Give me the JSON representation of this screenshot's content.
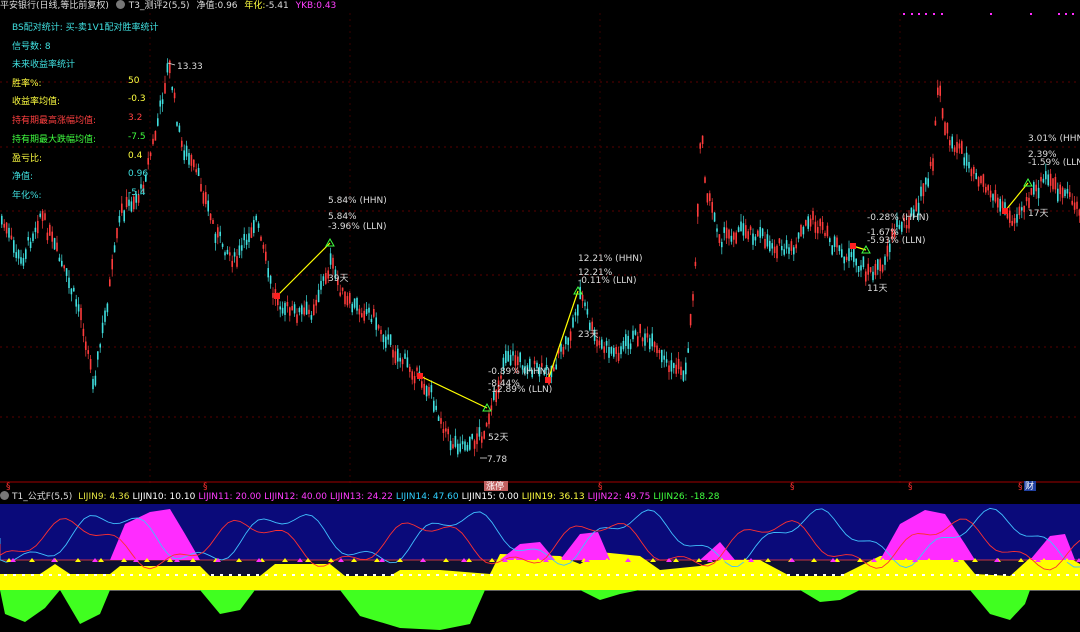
{
  "topbar": {
    "stock_title": "平安银行(日线,等比前复权)",
    "formula_name": "T3_测评2(5,5)",
    "net_label": "净值:",
    "net_value": "0.96",
    "annual_label": "年化:",
    "annual_value": "-5.41",
    "ykb_label": "YKB:",
    "ykb_value": "0.43"
  },
  "stats": {
    "line1": "BS配对统计: 买-卖1V1配对胜率统计",
    "line2": "信号数: 8",
    "line3": "未来收益率统计",
    "rows": [
      {
        "label": "胜率%:",
        "value": "50"
      },
      {
        "label": "收益率均值:",
        "value": "-0.3"
      },
      {
        "label": "持有期最高涨幅均值:",
        "value": "3.2"
      },
      {
        "label": "持有期最大跌幅均值:",
        "value": "-7.5"
      },
      {
        "label": "盈亏比:",
        "value": "0.4"
      },
      {
        "label": "净值:",
        "value": "0.96"
      },
      {
        "label": "年化%:",
        "value": "-5.4"
      }
    ]
  },
  "annotations": {
    "high": "13.33",
    "low": "7.78",
    "a1_hhn": "5.84% (HHN)",
    "a1_pct": "5.84%",
    "a1_lln": "-3.96% (LLN)",
    "a1_days": "39天",
    "a2_hhn": "-0.89% (HHN)",
    "a2_pct": "-8.44%",
    "a2_lln": "-12.89% (LLN)",
    "a2_days": "52天",
    "a3_hhn": "12.21% (HHN)",
    "a3_pct": "12.21%",
    "a3_lln": "-0.11% (LLN)",
    "a3_days": "23天",
    "a4_hhn": "-0.28% (HHN)",
    "a4_pct": "-1.67%",
    "a4_lln": "-5.93% (LLN)",
    "a4_days": "11天",
    "a5_hhn": "3.01% (HHN)",
    "a5_pct": "2.39%",
    "a5_lln": "-1.59% (LLN)",
    "a5_days": "17天",
    "zt_label": "涨停",
    "cai_label": "财"
  },
  "indicator": {
    "formula_name": "T1_公式F(5,5)",
    "items": [
      {
        "label": "LIJIN9:",
        "value": "4.36",
        "color": "#e0e040"
      },
      {
        "label": "LIJIN10:",
        "value": "10.10",
        "color": "#ffffff"
      },
      {
        "label": "LIJIN11:",
        "value": "20.00",
        "color": "#ff3cff"
      },
      {
        "label": "LIJIN12:",
        "value": "40.00",
        "color": "#ff3cff"
      },
      {
        "label": "LIJIN13:",
        "value": "24.22",
        "color": "#ff3cff"
      },
      {
        "label": "LIJIN14:",
        "value": "47.60",
        "color": "#30d0ff"
      },
      {
        "label": "LIJIN15:",
        "value": "0.00",
        "color": "#ffffff"
      },
      {
        "label": "LIJIN19:",
        "value": "36.13",
        "color": "#ffff40"
      },
      {
        "label": "LIJIN22:",
        "value": "49.75",
        "color": "#ff3cff"
      },
      {
        "label": "LIJIN26:",
        "value": "-18.28",
        "color": "#40ff40"
      }
    ]
  },
  "colors": {
    "up": "#ff3c3c",
    "down": "#40e0e0",
    "magenta": "#ff2cff",
    "yellow": "#ffff00",
    "green": "#40ff20",
    "navy": "#0a0a7a"
  }
}
